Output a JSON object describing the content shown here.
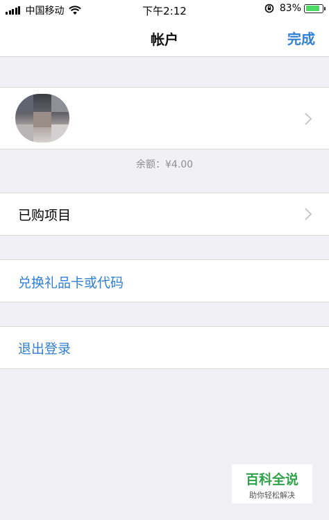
{
  "status_bar": {
    "carrier": "中国移动",
    "time": "下午2:12",
    "battery_percent": "83%",
    "battery_level": 0.83,
    "icons": [
      "signal-icon",
      "wifi-icon",
      "rotation-lock-icon",
      "battery-icon"
    ]
  },
  "nav": {
    "title": "帐户",
    "done_label": "完成"
  },
  "account": {
    "balance": "余额：¥4.00"
  },
  "menu": {
    "purchased": "已购项目",
    "redeem": "兑换礼品卡或代码",
    "sign_out": "退出登录"
  },
  "watermark": {
    "title": "百科全说",
    "subtitle": "助你轻松解决"
  },
  "colors": {
    "accent": "#2f7fd4",
    "background": "#f0f0f5",
    "battery": "#4cd964",
    "watermark": "#2fa24a"
  }
}
